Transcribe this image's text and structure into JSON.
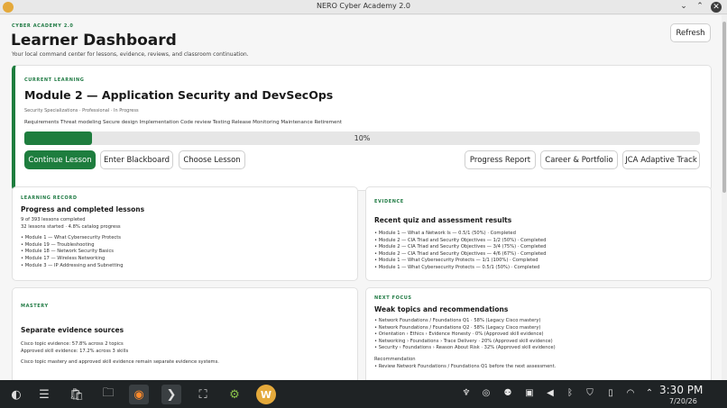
{
  "window": {
    "title": "NERO Cyber Academy 2.0",
    "min": "⌄",
    "max": "⌃",
    "close": "✕"
  },
  "header": {
    "kicker": "CYBER ACADEMY 2.0",
    "title": "Learner Dashboard",
    "subtitle": "Your local command center for lessons, evidence, reviews, and classroom continuation.",
    "refresh_label": "Refresh"
  },
  "current": {
    "kicker": "CURRENT LEARNING",
    "title": "Module 2 — Application Security and DevSecOps",
    "meta": "Security Specializations · Professional · In Progress",
    "steps": "Requirements Threat modeling Secure design Implementation Code review Testing Release Monitoring Maintenance Retirement",
    "progress_text": "10%",
    "progress_fraction": 0.1,
    "buttons": {
      "continue": "Continue Lesson",
      "blackboard": "Enter Blackboard",
      "choose": "Choose Lesson",
      "report": "Progress Report",
      "career": "Career & Portfolio",
      "jca": "JCA Adaptive Track"
    }
  },
  "record": {
    "kicker": "LEARNING RECORD",
    "title": "Progress and completed lessons",
    "stats": [
      "9 of 393 lessons completed",
      "32 lessons started · 4.8% catalog progress"
    ],
    "items": [
      "• Module 1 — What Cybersecurity Protects",
      "• Module 19 — Troubleshooting",
      "• Module 18 — Network Security Basics",
      "• Module 17 — Wireless Networking",
      "• Module 3 — IP Addressing and Subnetting"
    ]
  },
  "evidence": {
    "kicker": "EVIDENCE",
    "title": "Recent quiz and assessment results",
    "items": [
      "• Module 1 — What a Network Is — 0.5/1 (50%) · Completed",
      "• Module 2 — CIA Triad and Security Objectives — 1/2 (50%) · Completed",
      "• Module 2 — CIA Triad and Security Objectives — 3/4 (75%) · Completed",
      "• Module 2 — CIA Triad and Security Objectives — 4/6 (67%) · Completed",
      "• Module 1 — What Cybersecurity Protects — 1/1 (100%) · Completed",
      "• Module 1 — What Cybersecurity Protects — 0.5/1 (50%) · Completed"
    ]
  },
  "mastery": {
    "kicker": "MASTERY",
    "title": "Separate evidence sources",
    "lines": [
      "Cisco topic evidence: 57.8% across 2 topics",
      "Approved skill evidence: 17.2% across 3 skills"
    ],
    "note": "Cisco topic mastery and approved skill evidence remain separate evidence systems."
  },
  "focus": {
    "kicker": "NEXT FOCUS",
    "title": "Weak topics and recommendations",
    "items": [
      "• Network Foundations / Foundations Q1 · 58% (Legacy Cisco mastery)",
      "• Network Foundations / Foundations Q2 · 58% (Legacy Cisco mastery)",
      "• Orientation › Ethics › Evidence Honesty · 0% (Approved skill evidence)",
      "• Networking › Foundations › Trace Delivery · 20% (Approved skill evidence)",
      "• Security › Foundations › Reason About Risk · 32% (Approved skill evidence)"
    ],
    "rec_label": "Recommendation",
    "rec": "• Review Network Foundations / Foundations Q1 before the next assessment."
  },
  "taskbar": {
    "apps": [
      {
        "name": "start-menu-icon",
        "glyph": "◐"
      },
      {
        "name": "system-settings-icon",
        "glyph": "☰"
      },
      {
        "name": "discover-store-icon",
        "glyph": "🛍"
      },
      {
        "name": "file-manager-icon",
        "glyph": "🗀"
      },
      {
        "name": "firefox-icon",
        "glyph": "◉"
      },
      {
        "name": "terminal-icon",
        "glyph": "❯"
      },
      {
        "name": "screenshot-icon",
        "glyph": "⛶"
      },
      {
        "name": "steam-app-icon",
        "glyph": "⚙"
      },
      {
        "name": "nero-academy-app-icon",
        "glyph": "W"
      }
    ],
    "tray": [
      {
        "name": "network-tray-icon",
        "glyph": "♆"
      },
      {
        "name": "steam-tray-icon",
        "glyph": "◎"
      },
      {
        "name": "updates-tray-icon",
        "glyph": "⚉"
      },
      {
        "name": "clipboard-tray-icon",
        "glyph": "▣"
      },
      {
        "name": "volume-tray-icon",
        "glyph": "◀"
      },
      {
        "name": "bluetooth-tray-icon",
        "glyph": "ᛒ"
      },
      {
        "name": "shield-tray-icon",
        "glyph": "⛉"
      },
      {
        "name": "battery-tray-icon",
        "glyph": "▯"
      },
      {
        "name": "wifi-tray-icon",
        "glyph": "◠"
      },
      {
        "name": "expand-tray-icon",
        "glyph": "⌃"
      }
    ],
    "time": "3:30 PM",
    "date": "7/20/26"
  }
}
